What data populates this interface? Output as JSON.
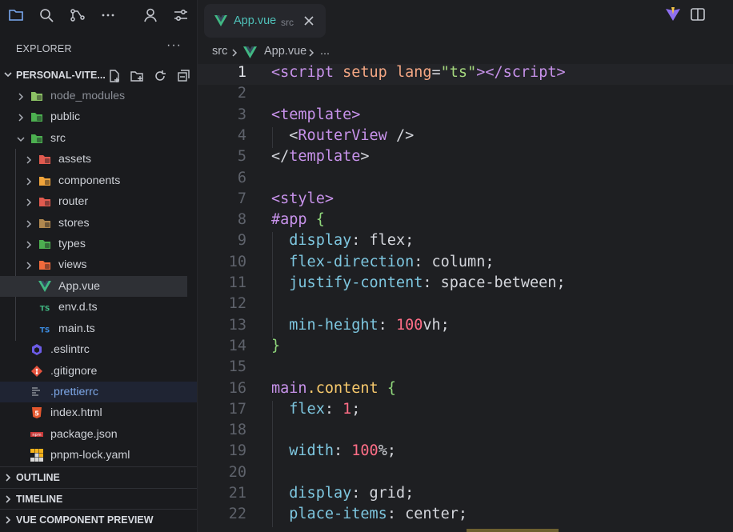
{
  "explorer": {
    "title": "EXPLORER",
    "more": "···",
    "project": "PERSONAL-VITE...",
    "items": [
      {
        "label": "node_modules",
        "icon": "node-folder-icon",
        "color": "#8cc265"
      },
      {
        "label": "public",
        "icon": "public-folder-icon",
        "color": "#4caf50"
      },
      {
        "label": "src",
        "icon": "src-folder-icon",
        "color": "#4caf50"
      },
      {
        "label": "assets",
        "icon": "assets-folder-icon",
        "color": "#e05a4f"
      },
      {
        "label": "components",
        "icon": "components-folder-icon",
        "color": "#f0a43b"
      },
      {
        "label": "router",
        "icon": "router-folder-icon",
        "color": "#e05a4f"
      },
      {
        "label": "stores",
        "icon": "stores-folder-icon",
        "color": "#b0884f"
      },
      {
        "label": "types",
        "icon": "types-folder-icon",
        "color": "#4caf50"
      },
      {
        "label": "views",
        "icon": "views-folder-icon",
        "color": "#f06a3b"
      },
      {
        "label": "App.vue",
        "icon": "vue-file-icon",
        "color": "#41b883"
      },
      {
        "label": "env.d.ts",
        "icon": "ts-file-icon",
        "color": "#41b883"
      },
      {
        "label": "main.ts",
        "icon": "ts-file-icon",
        "color": "#3b8be0"
      },
      {
        "label": ".eslintrc",
        "icon": "eslint-file-icon",
        "color": "#6c5ce7"
      },
      {
        "label": ".gitignore",
        "icon": "git-file-icon",
        "color": "#e5533d"
      },
      {
        "label": ".prettierrc",
        "icon": "prettier-file-icon",
        "color": "#8a8e96"
      },
      {
        "label": "index.html",
        "icon": "html-file-icon",
        "color": "#e4572e"
      },
      {
        "label": "package.json",
        "icon": "npm-file-icon",
        "color": "#c83a3a"
      },
      {
        "label": "pnpm-lock.yaml",
        "icon": "pnpm-file-icon",
        "color": "#f6b21b"
      }
    ],
    "sections": [
      "OUTLINE",
      "TIMELINE",
      "VUE COMPONENT PREVIEW"
    ]
  },
  "tab": {
    "name": "App.vue",
    "dir": "src"
  },
  "breadcrumb": {
    "folder": "src",
    "file": "App.vue",
    "ellipsis": "..."
  },
  "code": {
    "active_line": 1,
    "lines": [
      {
        "n": "1",
        "tokens": [
          [
            "t-tag",
            "<script"
          ],
          [
            "t-punct",
            " "
          ],
          [
            "t-attr",
            "setup"
          ],
          [
            "t-punct",
            " "
          ],
          [
            "t-attr",
            "lang"
          ],
          [
            "t-punct",
            "="
          ],
          [
            "t-str",
            "\"ts\""
          ],
          [
            "t-tag",
            "></"
          ],
          [
            "t-tag",
            "script"
          ],
          [
            "t-tag",
            ">"
          ]
        ]
      },
      {
        "n": "2",
        "tokens": []
      },
      {
        "n": "3",
        "tokens": [
          [
            "t-tag",
            "<template>"
          ]
        ]
      },
      {
        "n": "4",
        "tokens": [
          [
            "t-punct",
            "  "
          ],
          [
            "t-punct",
            "<"
          ],
          [
            "t-comp",
            "RouterView"
          ],
          [
            "t-punct",
            " />"
          ]
        ]
      },
      {
        "n": "5",
        "tokens": [
          [
            "t-punct",
            "</"
          ],
          [
            "t-tag",
            "template"
          ],
          [
            "t-punct",
            ">"
          ]
        ]
      },
      {
        "n": "6",
        "tokens": []
      },
      {
        "n": "7",
        "tokens": [
          [
            "t-tag",
            "<style>"
          ]
        ]
      },
      {
        "n": "8",
        "tokens": [
          [
            "t-sel",
            "#app"
          ],
          [
            "t-punct",
            " "
          ],
          [
            "t-brace",
            "{"
          ]
        ]
      },
      {
        "n": "9",
        "tokens": [
          [
            "t-punct",
            "  "
          ],
          [
            "t-prop",
            "display"
          ],
          [
            "t-punct",
            ": "
          ],
          [
            "t-val",
            "flex"
          ],
          [
            "t-punct",
            ";"
          ]
        ]
      },
      {
        "n": "10",
        "tokens": [
          [
            "t-punct",
            "  "
          ],
          [
            "t-prop",
            "flex-direction"
          ],
          [
            "t-punct",
            ": "
          ],
          [
            "t-val",
            "column"
          ],
          [
            "t-punct",
            ";"
          ]
        ]
      },
      {
        "n": "11",
        "tokens": [
          [
            "t-punct",
            "  "
          ],
          [
            "t-prop",
            "justify-content"
          ],
          [
            "t-punct",
            ": "
          ],
          [
            "t-val",
            "space-between"
          ],
          [
            "t-punct",
            ";"
          ]
        ]
      },
      {
        "n": "12",
        "tokens": []
      },
      {
        "n": "13",
        "tokens": [
          [
            "t-punct",
            "  "
          ],
          [
            "t-prop",
            "min-height"
          ],
          [
            "t-punct",
            ": "
          ],
          [
            "t-num",
            "100"
          ],
          [
            "t-unit",
            "vh"
          ],
          [
            "t-punct",
            ";"
          ]
        ]
      },
      {
        "n": "14",
        "tokens": [
          [
            "t-brace",
            "}"
          ]
        ]
      },
      {
        "n": "15",
        "tokens": []
      },
      {
        "n": "16",
        "tokens": [
          [
            "t-sel",
            "main"
          ],
          [
            "t-sel2",
            ".content"
          ],
          [
            "t-punct",
            " "
          ],
          [
            "t-brace",
            "{"
          ]
        ]
      },
      {
        "n": "17",
        "tokens": [
          [
            "t-punct",
            "  "
          ],
          [
            "t-prop",
            "flex"
          ],
          [
            "t-punct",
            ": "
          ],
          [
            "t-num",
            "1"
          ],
          [
            "t-punct",
            ";"
          ]
        ]
      },
      {
        "n": "18",
        "tokens": []
      },
      {
        "n": "19",
        "tokens": [
          [
            "t-punct",
            "  "
          ],
          [
            "t-prop",
            "width"
          ],
          [
            "t-punct",
            ": "
          ],
          [
            "t-num",
            "100"
          ],
          [
            "t-unit",
            "%"
          ],
          [
            "t-punct",
            ";"
          ]
        ]
      },
      {
        "n": "20",
        "tokens": []
      },
      {
        "n": "21",
        "tokens": [
          [
            "t-punct",
            "  "
          ],
          [
            "t-prop",
            "display"
          ],
          [
            "t-punct",
            ": "
          ],
          [
            "t-val",
            "grid"
          ],
          [
            "t-punct",
            ";"
          ]
        ]
      },
      {
        "n": "22",
        "tokens": [
          [
            "t-punct",
            "  "
          ],
          [
            "t-prop",
            "place-items"
          ],
          [
            "t-punct",
            ": "
          ],
          [
            "t-val",
            "center"
          ],
          [
            "t-punct",
            ";"
          ]
        ]
      }
    ]
  }
}
